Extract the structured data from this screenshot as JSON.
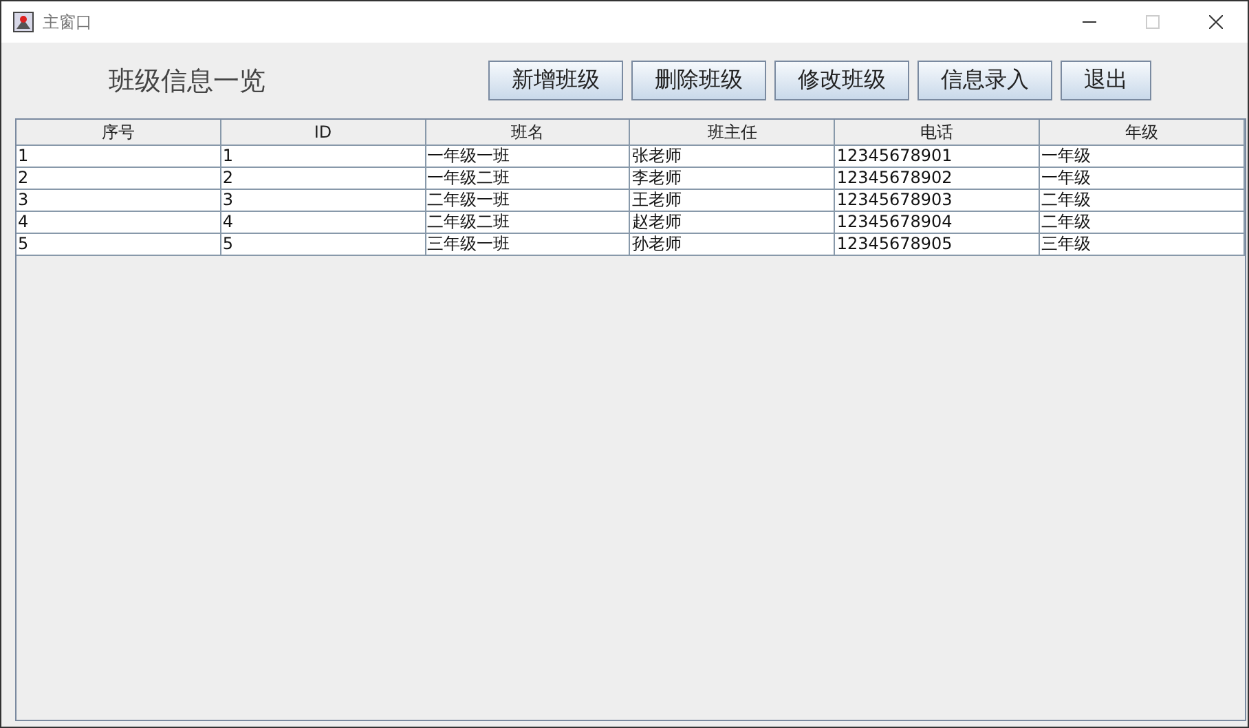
{
  "window": {
    "title": "主窗口"
  },
  "heading": "班级信息一览",
  "buttons": [
    "新增班级",
    "删除班级",
    "修改班级",
    "信息录入",
    "退出"
  ],
  "table": {
    "columns": [
      "序号",
      "ID",
      "班名",
      "班主任",
      "电话",
      "年级"
    ],
    "rows": [
      [
        "1",
        "1",
        "一年级一班",
        "张老师",
        "12345678901",
        "一年级"
      ],
      [
        "2",
        "2",
        "一年级二班",
        "李老师",
        "12345678902",
        "一年级"
      ],
      [
        "3",
        "3",
        "二年级一班",
        "王老师",
        "12345678903",
        "二年级"
      ],
      [
        "4",
        "4",
        "二年级二班",
        "赵老师",
        "12345678904",
        "二年级"
      ],
      [
        "5",
        "5",
        "三年级一班",
        "孙老师",
        "12345678905",
        "三年级"
      ]
    ]
  }
}
